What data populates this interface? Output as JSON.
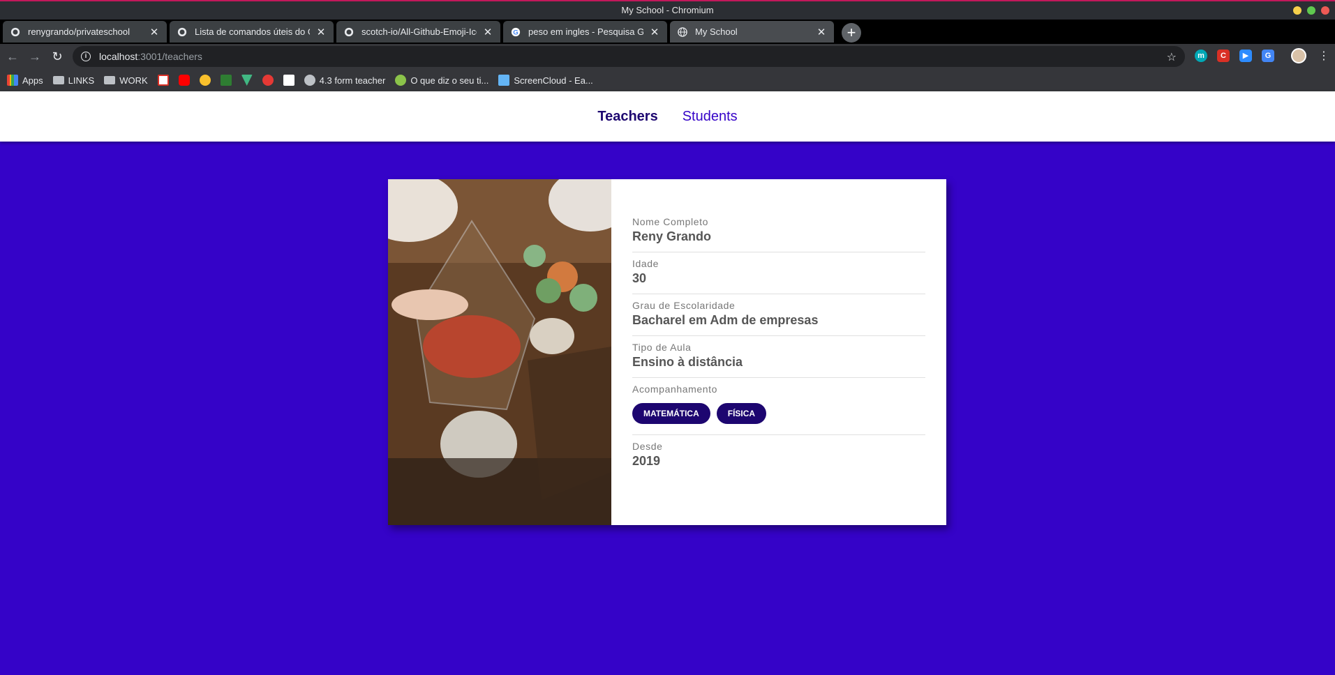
{
  "window": {
    "title": "My School - Chromium"
  },
  "tabs": [
    {
      "label": "renygrando/privateschool",
      "icon": "github-icon"
    },
    {
      "label": "Lista de comandos úteis do Gi",
      "icon": "github-icon"
    },
    {
      "label": "scotch-io/All-Github-Emoji-Ico",
      "icon": "github-icon"
    },
    {
      "label": "peso em ingles - Pesquisa Goo",
      "icon": "google-icon"
    },
    {
      "label": "My School",
      "icon": "globe-icon"
    }
  ],
  "address_bar": {
    "host": "localhost",
    "path": ":3001/teachers"
  },
  "bookmarks": {
    "apps": "Apps",
    "links": "LINKS",
    "work": "WORK",
    "form_teacher": "4.3 form teacher",
    "o_que_diz": "O que diz o seu ti...",
    "screencloud": "ScreenCloud - Ea..."
  },
  "nav": {
    "teachers": "Teachers",
    "students": "Students"
  },
  "teacher": {
    "name_label": "Nome Completo",
    "name": "Reny Grando",
    "age_label": "Idade",
    "age": "30",
    "education_label": "Grau de Escolaridade",
    "education": "Bacharel em Adm de empresas",
    "class_type_label": "Tipo de Aula",
    "class_type": "Ensino à distância",
    "subjects_label": "Acompanhamento",
    "subjects": [
      "MATEMÁTICA",
      "FÍSICA"
    ],
    "since_label": "Desde",
    "since": "2019"
  },
  "colors": {
    "page_background": "#3503c8",
    "pill_background": "#1d0670",
    "active_nav": "#1d0670"
  }
}
